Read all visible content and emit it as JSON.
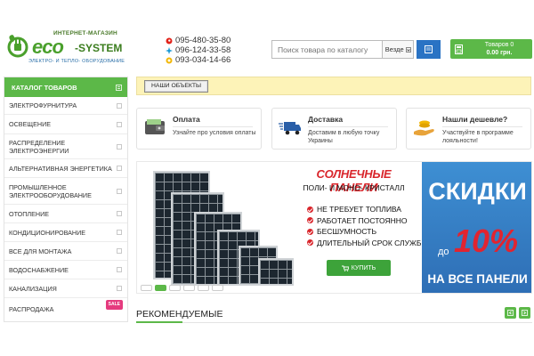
{
  "header": {
    "logo": {
      "tagline_top": "ИНТЕРНЕТ-МАГАЗИН",
      "brand_eco": "eco",
      "brand_system": "-SYSTEM",
      "tagline_bottom": "ЭЛЕКТРО- И ТЕПЛО- ОБОРУДОВАНИЕ"
    },
    "phones": [
      {
        "number": "095-480-35-80",
        "icon": "vodafone-icon",
        "color": "#e2231a"
      },
      {
        "number": "096-124-33-58",
        "icon": "kyivstar-icon",
        "color": "#1a9ad6"
      },
      {
        "number": "093-034-14-66",
        "icon": "lifecell-icon",
        "color": "#f2b705"
      }
    ],
    "search": {
      "placeholder": "Поиск товара по каталогу",
      "scope": "Везде",
      "button_icon": "search-icon"
    },
    "cart": {
      "label": "Товаров 0",
      "amount": "0.00 грн."
    }
  },
  "sidebar": {
    "title": "КАТАЛОГ ТОВАРОВ",
    "items": [
      {
        "label": "ЭЛЕКТРОФУРНИТУРА"
      },
      {
        "label": "ОСВЕЩЕНИЕ"
      },
      {
        "label": "РАСПРЕДЕЛЕНИЕ ЭЛЕКТРОЭНЕРГИИ"
      },
      {
        "label": "АЛЬТЕРНАТИВНАЯ ЭНЕРГЕТИКА"
      },
      {
        "label": "ПРОМЫШЛЕННОЕ ЭЛЕКТРООБОРУДОВАНИЕ"
      },
      {
        "label": "ОТОПЛЕНИЕ"
      },
      {
        "label": "КОНДИЦИОНИРОВАНИЕ"
      },
      {
        "label": "ВСЕ ДЛЯ МОНТАЖА"
      },
      {
        "label": "ВОДОСНАБЖЕНИЕ"
      },
      {
        "label": "КАНАЛИЗАЦИЯ"
      },
      {
        "label": "РАСПРОДАЖА",
        "badge": "SALE"
      }
    ]
  },
  "objects_bar": {
    "button": "НАШИ ОБЪЕКТЫ"
  },
  "info_boxes": [
    {
      "title": "Оплата",
      "desc": "Узнайте про условия оплаты",
      "icon": "wallet-icon"
    },
    {
      "title": "Доставка",
      "desc": "Доставим в любую точку Украины",
      "icon": "truck-icon"
    },
    {
      "title": "Нашли дешевле?",
      "desc": "Участвуйте в программе лояльности!",
      "icon": "hand-coins-icon"
    }
  ],
  "banner": {
    "title": "СОЛНЕЧНЫЕ ПАНЕЛИ",
    "subtitle": "ПОЛИ- И МОНО- КРИСТАЛЛ",
    "features": [
      "НЕ ТРЕБУЕТ ТОПЛИВА",
      "РАБОТАЕТ ПОСТОЯННО",
      "БЕСШУМНОСТЬ",
      "ДЛИТЕЛЬНЫЙ СРОК СЛУЖБЫ"
    ],
    "buy_button": "КУПИТЬ",
    "sale_word": "СКИДКИ",
    "sale_prefix": "до",
    "sale_percent": "10%",
    "sale_bottom": "НА ВСЕ ПАНЕЛИ",
    "slides": 6,
    "active_slide": 2
  },
  "recommended": {
    "title": "РЕКОМЕНДУЕМЫЕ"
  },
  "colors": {
    "brand_green": "#5cb848",
    "brand_blue": "#2a73c4",
    "sale_red": "#d9252b"
  }
}
